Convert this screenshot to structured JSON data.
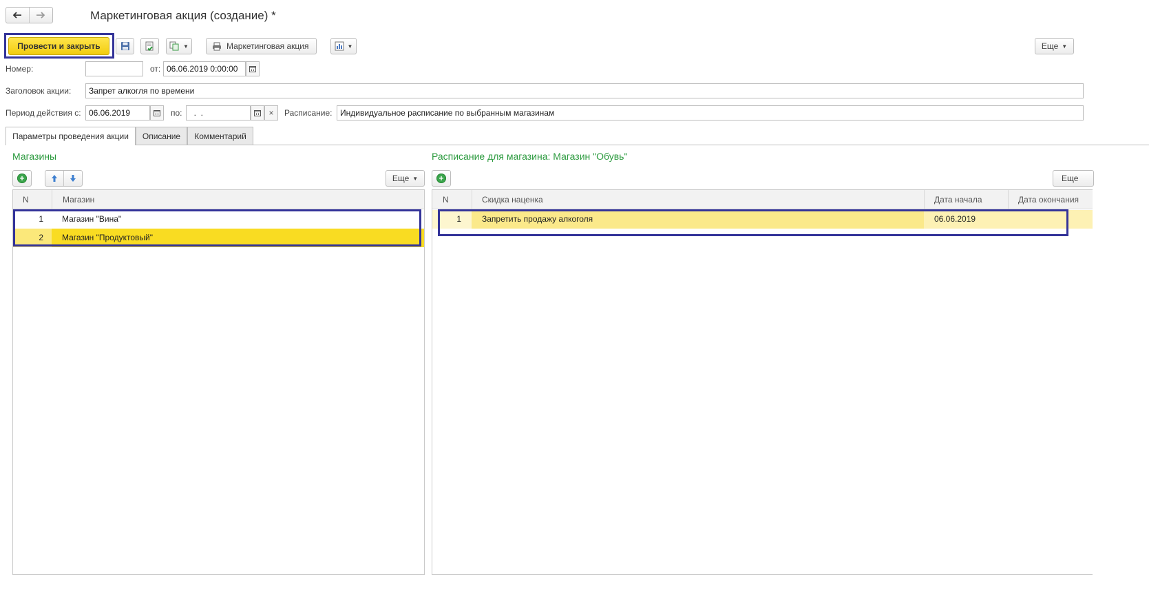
{
  "window": {
    "title": "Маркетинговая акция (создание) *",
    "back_icon": "arrow-left-icon",
    "forward_icon": "arrow-right-icon"
  },
  "toolbar": {
    "post_close_label": "Провести и закрыть",
    "print_label": "Маркетинговая акция",
    "more_label": "Еще"
  },
  "form": {
    "number_label": "Номер:",
    "number_value": "",
    "from_label": "от:",
    "from_value": "06.06.2019  0:00:00",
    "title_label": "Заголовок акции:",
    "title_value": "Запрет алкогля по времени",
    "period_label": "Период действия с:",
    "period_from_value": "06.06.2019",
    "period_to_label": "по:",
    "period_to_value": "  .  .",
    "schedule_label": "Расписание:",
    "schedule_value": "Индивидуальное расписание по выбранным магазинам",
    "clear_glyph": "×"
  },
  "tabs": [
    {
      "label": "Параметры проведения акции",
      "active": true
    },
    {
      "label": "Описание",
      "active": false
    },
    {
      "label": "Комментарий",
      "active": false
    }
  ],
  "stores": {
    "title": "Магазины",
    "more_label": "Еще",
    "columns": [
      "N",
      "Магазин"
    ],
    "rows": [
      {
        "n": "1",
        "name": "Магазин \"Вина\"",
        "selected": false
      },
      {
        "n": "2",
        "name": "Магазин \"Продуктовый\"",
        "selected": true
      }
    ]
  },
  "schedule": {
    "title": "Расписание для магазина: Магазин \"Обувь\"",
    "more_label": "Еще",
    "columns": [
      "N",
      "Скидка наценка",
      "Дата начала",
      "Дата окончания"
    ],
    "rows": [
      {
        "n": "1",
        "discount": "Запретить продажу алкоголя",
        "start": "06.06.2019",
        "end": ""
      }
    ]
  },
  "colors": {
    "accent_yellow": "#f7d51e",
    "selected_row": "#f9dc22",
    "highlight_frame": "#333399",
    "group_title": "#2b9a3e"
  }
}
